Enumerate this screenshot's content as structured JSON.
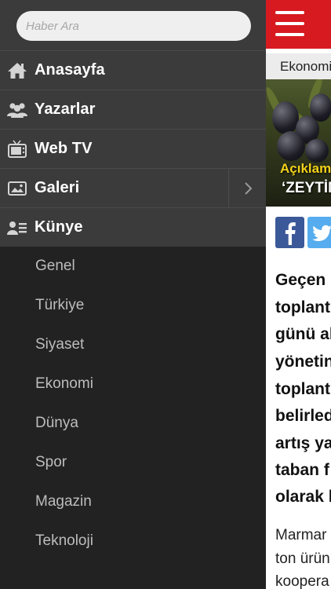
{
  "drawer": {
    "search_placeholder": "Haber Ara",
    "main_items": [
      {
        "label": "Anasayfa",
        "icon": "home-icon"
      },
      {
        "label": "Yazarlar",
        "icon": "users-icon"
      },
      {
        "label": "Web TV",
        "icon": "tv-icon"
      },
      {
        "label": "Galeri",
        "icon": "gallery-icon"
      },
      {
        "label": "Künye",
        "icon": "contact-card-icon"
      }
    ],
    "sub_items": [
      "Genel",
      "Türkiye",
      "Siyaset",
      "Ekonomi",
      "Dünya",
      "Spor",
      "Magazin",
      "Teknoloji"
    ]
  },
  "content": {
    "category": "Ekonomi",
    "hero_caption_1": "Açıklam",
    "hero_caption_2": "‘ZEYTİN",
    "headline_lines": [
      "Geçen h",
      "toplant",
      "günü al",
      "yönetin",
      "toplant",
      "belirled",
      "artış ya",
      "taban f",
      "olarak b"
    ],
    "body_lines": [
      "Marmar",
      "ton ürün",
      "koopera"
    ]
  },
  "colors": {
    "brand_red": "#d71920",
    "drawer_bg": "#222222",
    "drawer_item_bg": "#3b3b3b"
  }
}
